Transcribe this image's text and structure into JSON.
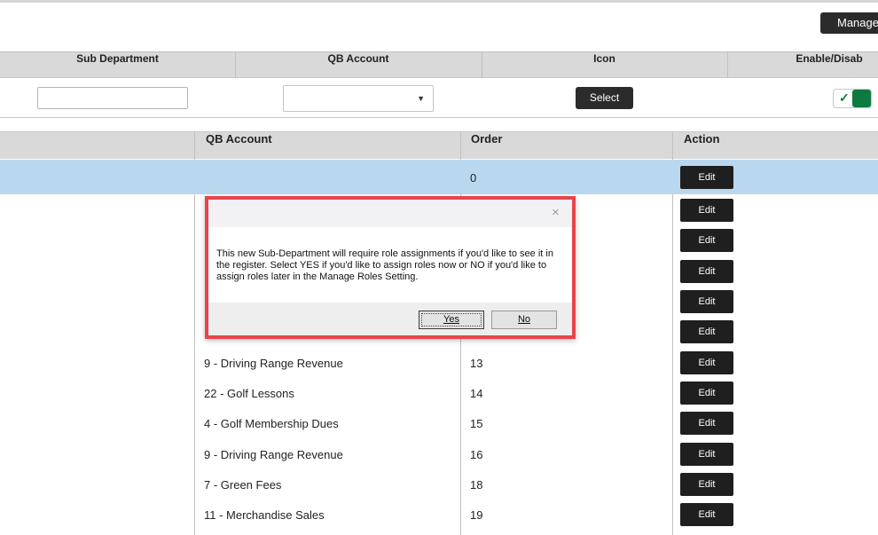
{
  "header": {
    "manage_label": "Manage"
  },
  "add_form": {
    "columns": [
      "Sub Department",
      "QB Account",
      "Icon",
      "Enable/Disab"
    ],
    "icon_select_label": "Select",
    "enabled": true
  },
  "list": {
    "columns": [
      "QB Account",
      "Order",
      "Action"
    ],
    "edit_label": "Edit",
    "selected_row": {
      "qb_account": "",
      "order": "0"
    },
    "rows": [
      {
        "qb_account": "9 - Driving Range Revenue",
        "order": "13"
      },
      {
        "qb_account": "22 - Golf Lessons",
        "order": "14"
      },
      {
        "qb_account": "4 - Golf Membership Dues",
        "order": "15"
      },
      {
        "qb_account": "9 - Driving Range Revenue",
        "order": "16"
      },
      {
        "qb_account": "7 - Green Fees",
        "order": "18"
      },
      {
        "qb_account": "11 - Merchandise Sales",
        "order": "19"
      }
    ]
  },
  "dialog": {
    "message": "This new Sub-Department will require role assignments if you'd like to see it in the register. Select YES if you'd like to assign roles now or NO if you'd like to assign roles later in the Manage Roles Setting.",
    "yes_label": "Yes",
    "no_label": "No",
    "close_glyph": "×"
  },
  "colors": {
    "highlight_row": "#b9d8ef",
    "toggle_on": "#0f7a40",
    "dialog_border": "#e8444d"
  }
}
